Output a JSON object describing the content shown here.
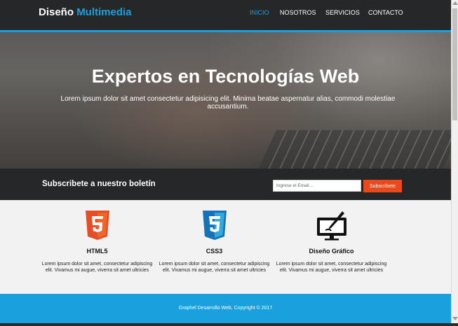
{
  "header": {
    "logo_main": "Diseño",
    "logo_accent": "Multimedia",
    "nav": [
      "INICIO",
      "NOSOTROS",
      "SERVICIOS",
      "CONTACTO"
    ],
    "nav_active": "INICIO"
  },
  "hero": {
    "title": "Expertos en Tecnologías Web",
    "text": "Lorem ipsum dolor sit amet consectetur adipisicing elit. Minima beatae aspernatur alias, commodi molestiae accusantium."
  },
  "newsletter": {
    "title": "Subscribete a nuestro boletín",
    "email_placeholder": "Ingrese el Email...",
    "button_label": "Subscribete"
  },
  "features": [
    {
      "icon": "html5-icon",
      "title": "HTML5",
      "text": "Lorem ipsum dolor sit amet, consectetur adipiscing elit. Vivamus mi augue, viverra sit amet ultricies"
    },
    {
      "icon": "css3-icon",
      "title": "CSS3",
      "text": "Lorem ipsum dolor sit amet, consectetur adipiscing elit. Vivamus mi augue, viverra sit amet ultricies"
    },
    {
      "icon": "graphic-design-icon",
      "title": "Diseño Gráfico",
      "text": "Lorem ipsum dolor sit amet, consectetur adipiscing elit. Vivamus mi augue, viverra sit amet ultricies"
    }
  ],
  "footer": {
    "text": "Graphel Desarrollo Web, Copyright © 2017"
  },
  "colors": {
    "accent": "#1aa0dc",
    "dark": "#252729",
    "button": "#e8491d",
    "html5": "#e44d26",
    "css3": "#1572b6"
  }
}
